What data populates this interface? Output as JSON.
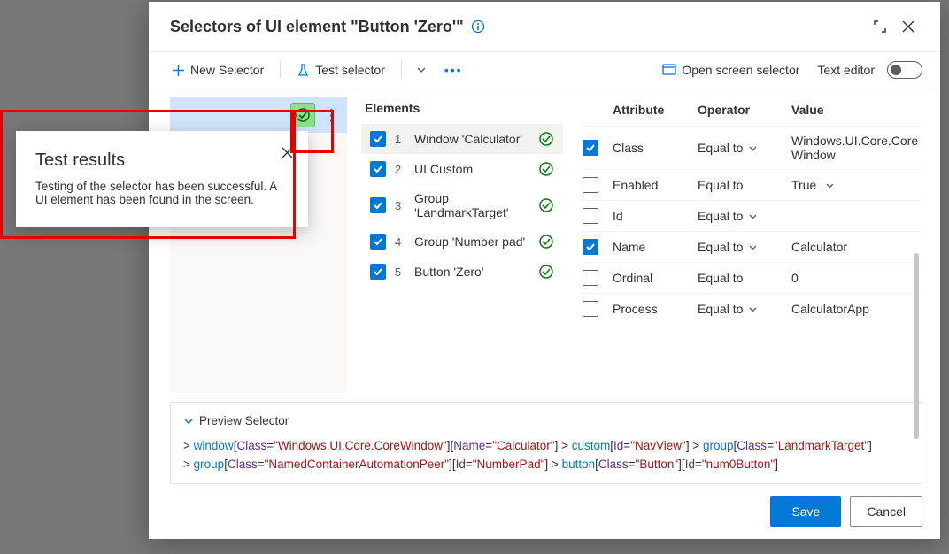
{
  "header": {
    "title": "Selectors of UI element \"Button 'Zero'\""
  },
  "toolbar": {
    "newSelector": "New Selector",
    "testSelector": "Test selector",
    "openScreen": "Open screen selector",
    "textEditor": "Text editor"
  },
  "elements": {
    "title": "Elements",
    "items": [
      {
        "n": "1",
        "label": "Window 'Calculator'"
      },
      {
        "n": "2",
        "label": "UI Custom"
      },
      {
        "n": "3",
        "label": "Group 'LandmarkTarget'"
      },
      {
        "n": "4",
        "label": "Group 'Number pad'"
      },
      {
        "n": "5",
        "label": "Button 'Zero'"
      }
    ]
  },
  "attributes": {
    "headAttr": "Attribute",
    "headOp": "Operator",
    "headVal": "Value",
    "rows": [
      {
        "on": true,
        "name": "Class",
        "op": "Equal to",
        "val": "Windows.UI.Core.CoreWindow",
        "chev": true
      },
      {
        "on": false,
        "name": "Enabled",
        "op": "Equal to",
        "val": "True",
        "chev": true
      },
      {
        "on": false,
        "name": "Id",
        "op": "Equal to",
        "val": "",
        "chev": true
      },
      {
        "on": true,
        "name": "Name",
        "op": "Equal to",
        "val": "Calculator",
        "chev": true
      },
      {
        "on": false,
        "name": "Ordinal",
        "op": "Equal to",
        "val": "0",
        "chev": false
      },
      {
        "on": false,
        "name": "Process",
        "op": "Equal to",
        "val": "CalculatorApp",
        "chev": true
      }
    ]
  },
  "preview": {
    "title": "Preview Selector",
    "segments": {
      "s1": {
        "kw": "window",
        "p1": "Class",
        "v1": "Windows.UI.Core.CoreWindow",
        "p2": "Name",
        "v2": "Calculator"
      },
      "s2": {
        "kw": "custom",
        "p1": "Id",
        "v1": "NavView"
      },
      "s3": {
        "kw": "group",
        "p1": "Class",
        "v1": "LandmarkTarget"
      },
      "s4": {
        "kw": "group",
        "p1": "Class",
        "v1": "NamedContainerAutomationPeer",
        "p2": "Id",
        "v2": "NumberPad"
      },
      "s5": {
        "kw": "button",
        "p1": "Class",
        "v1": "Button",
        "p2": "Id",
        "v2": "num0Button"
      }
    }
  },
  "footer": {
    "save": "Save",
    "cancel": "Cancel"
  },
  "toast": {
    "title": "Test results",
    "body": "Testing of the selector has been successful. A UI element has been found in the screen."
  },
  "icons": {
    "gt": ">",
    "eq": "=",
    "q": "\""
  }
}
